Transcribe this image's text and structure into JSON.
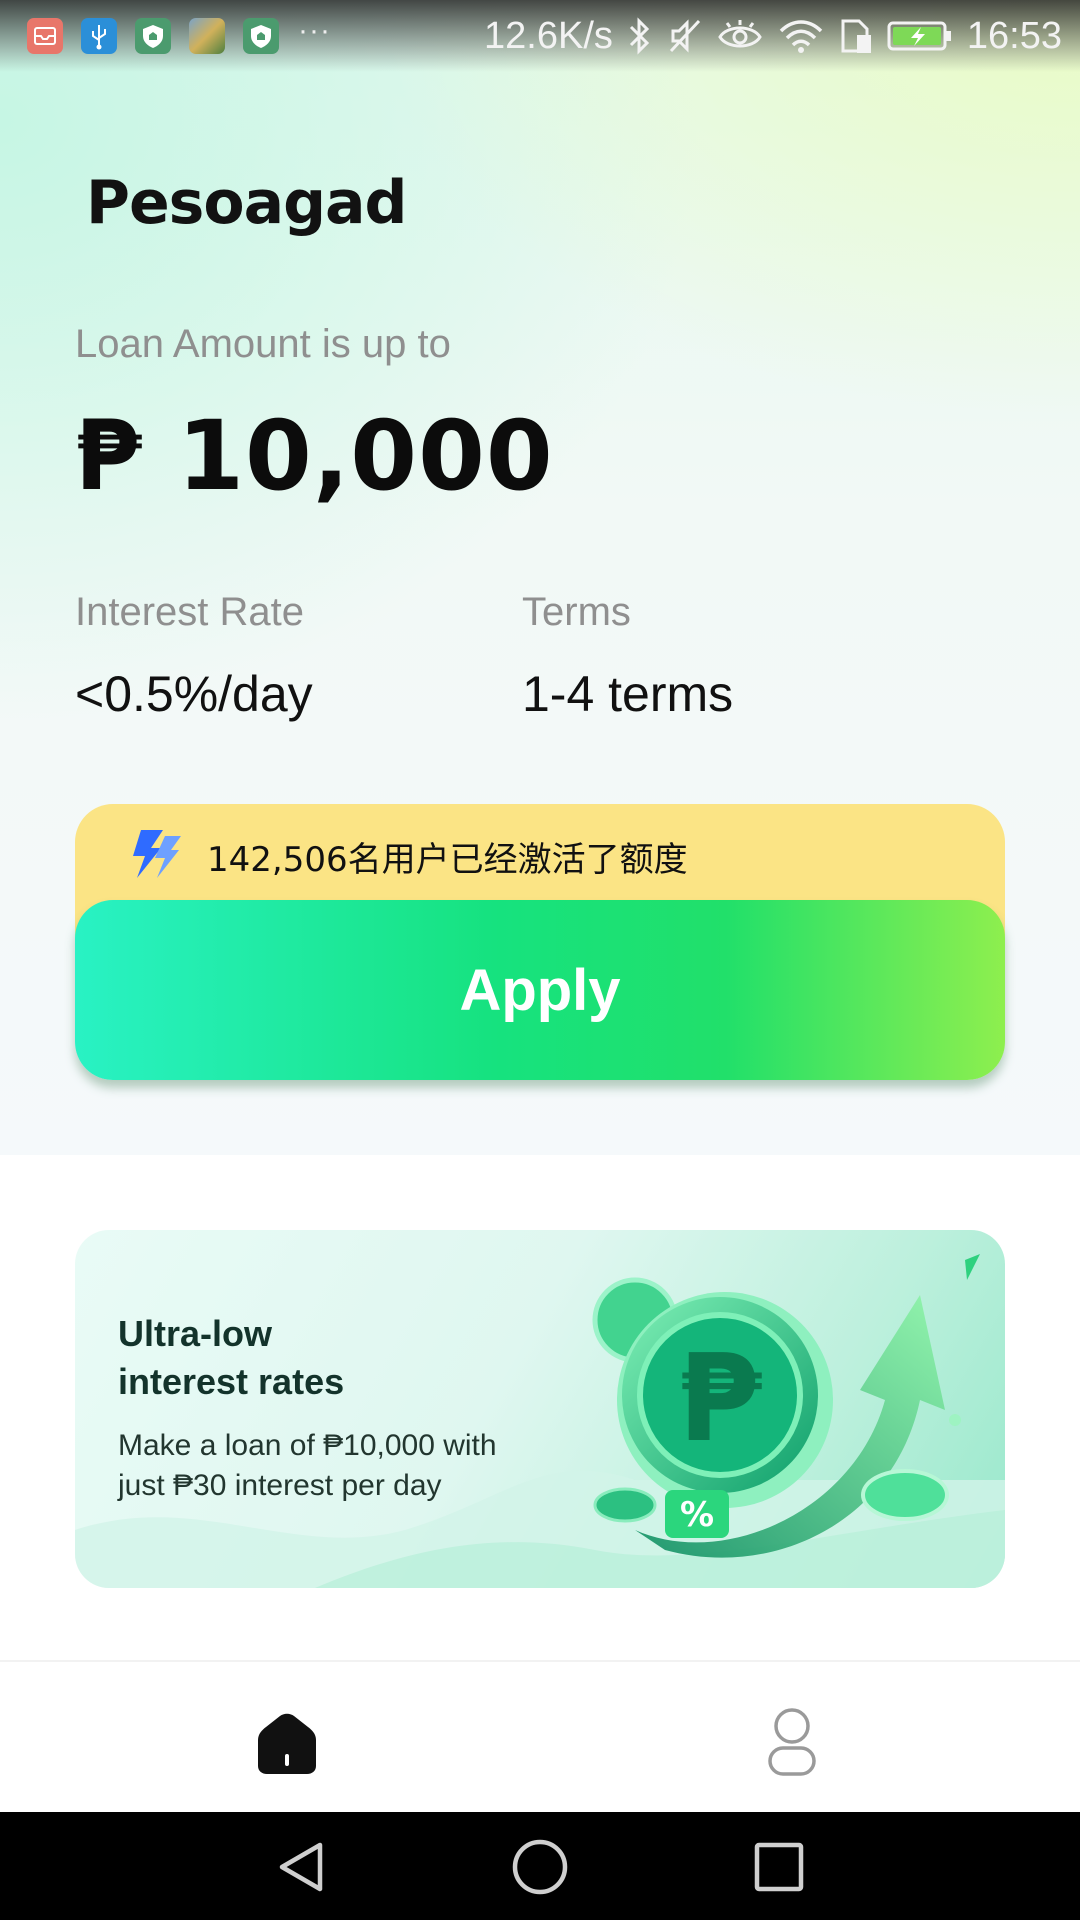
{
  "status_bar": {
    "net_speed": "12.6K/s",
    "time": "16:53",
    "notification_icons": [
      "mail-icon",
      "usb-icon",
      "shield-icon",
      "image-thumbnail-icon",
      "shield-icon"
    ],
    "overflow": "···",
    "system_icons": [
      "bluetooth-icon",
      "mute-icon",
      "eye-icon",
      "wifi-icon",
      "sim-icon",
      "battery-charging-icon"
    ]
  },
  "brand": {
    "name": "Pesoagad"
  },
  "loan": {
    "label": "Loan Amount is up to",
    "amount": "₱ 10,000"
  },
  "stats": {
    "interest_label": "Interest Rate",
    "interest_value": "<0.5%/day",
    "terms_label": "Terms",
    "terms_value": "1-4 terms"
  },
  "banner": {
    "icon": "lightning-icon",
    "text": "142,506名用户已经激活了额度"
  },
  "apply_button": {
    "label": "Apply"
  },
  "promo": {
    "title_line1": "Ultra-low",
    "title_line2": "interest rates",
    "desc_line1": "Make a loan of ₱10,000 with",
    "desc_line2": "just ₱30 interest per day",
    "badge": "%"
  },
  "bottom_nav": {
    "items": [
      {
        "icon": "home-icon",
        "active": true
      },
      {
        "icon": "profile-icon",
        "active": false
      }
    ]
  },
  "colors": {
    "apply_gradient_start": "#29f2c4",
    "apply_gradient_end": "#8eef4e",
    "banner_bg": "#fbe485",
    "accent_blue": "#2f6bff"
  }
}
